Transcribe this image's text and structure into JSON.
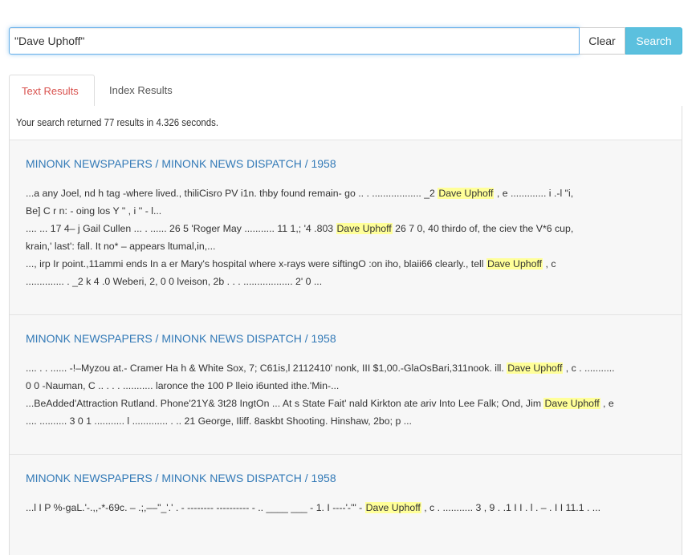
{
  "search": {
    "value": "\"Dave Uphoff\"",
    "clear_label": "Clear",
    "search_label": "Search"
  },
  "tabs": [
    {
      "label": "Text Results",
      "active": true
    },
    {
      "label": "Index Results",
      "active": false
    }
  ],
  "summary": "Your search returned 77 results in 4.326 seconds.",
  "colors": {
    "accent": "#5bc0de",
    "active_tab": "#d9534f",
    "link": "#337ab7",
    "highlight": "#ffff99"
  },
  "results": [
    {
      "title": "MINONK NEWSPAPERS / MINONK NEWS DISPATCH / 1958",
      "lines": [
        {
          "before": "...a any Joel, nd h tag -where lived., thiliCisro PV i1n. thby found remain- go .. . .................. _2  ",
          "hit": "Dave Uphoff",
          "after": " , e ............. i .-l \"i,"
        },
        {
          "before": "Be] C r n: - oing los Y \" , i '' - l...",
          "hit": "",
          "after": ""
        },
        {
          "before": ".... ... 17 4– j Gail Cullen ... . ...... 26 5 'Roger May ........... 11 1,; '4 .803  ",
          "hit": "Dave Uphoff",
          "after": " 26 7 0, 40 thirdo of, the ciev the V*6 cup,"
        },
        {
          "before": "krain,' last': fall. It no* – appears ltumal,in,...",
          "hit": "",
          "after": ""
        },
        {
          "before": "..., irp Ir point.,11ammi ends In a er Mary's hospital where x-rays were siftingO :on iho, blaii66 clearly., tell ",
          "hit": "Dave Uphoff",
          "after": " , c"
        },
        {
          "before": ".............. . _2 k 4 .0 Weberi, 2, 0 0 lveison, 2b . . . .................. 2' 0 ...",
          "hit": "",
          "after": ""
        }
      ]
    },
    {
      "title": "MINONK NEWSPAPERS / MINONK NEWS DISPATCH / 1958",
      "lines": [
        {
          "before": ".... . . ...... -!–Myzou at.- Cramer Ha h & White Sox, 7; C61is,l 2112410' nonk, III $1,00.-GlaOsBari,311nook. ill. ",
          "hit": "Dave Uphoff",
          "after": " , c . ..........."
        },
        {
          "before": "0 0 -Nauman, C .. . . . ........... laronce the 100 P lleio i6unted ithe.'Min-...",
          "hit": "",
          "after": ""
        },
        {
          "before": "...BeAdded'Attraction Rutland. Phone'21Y& 3t28 IngtOn ... At s State Fait' nald Kirkton ate ariv Into Lee Falk; Ond, Jim ",
          "hit": "Dave Uphoff",
          "after": " , e"
        },
        {
          "before": ".... .......... 3 0 1 ........... l ............. . .. 21 George, Iliff. 8askbt Shooting. Hinshaw, 2bo; p ...",
          "hit": "",
          "after": ""
        }
      ]
    },
    {
      "title": "MINONK NEWSPAPERS / MINONK NEWS DISPATCH / 1958",
      "lines": [
        {
          "before": "...l I P %-gaL.'-.,,-*-69c. – .;,––\"_'.' . - -------- ---------- - .. ____ ___ - 1. I ----'-'\" - ",
          "hit": "Dave Uphoff",
          "after": " , c . ........... 3 , 9 . .1 I I . l . – . I I 11.1 . ..."
        }
      ]
    }
  ]
}
